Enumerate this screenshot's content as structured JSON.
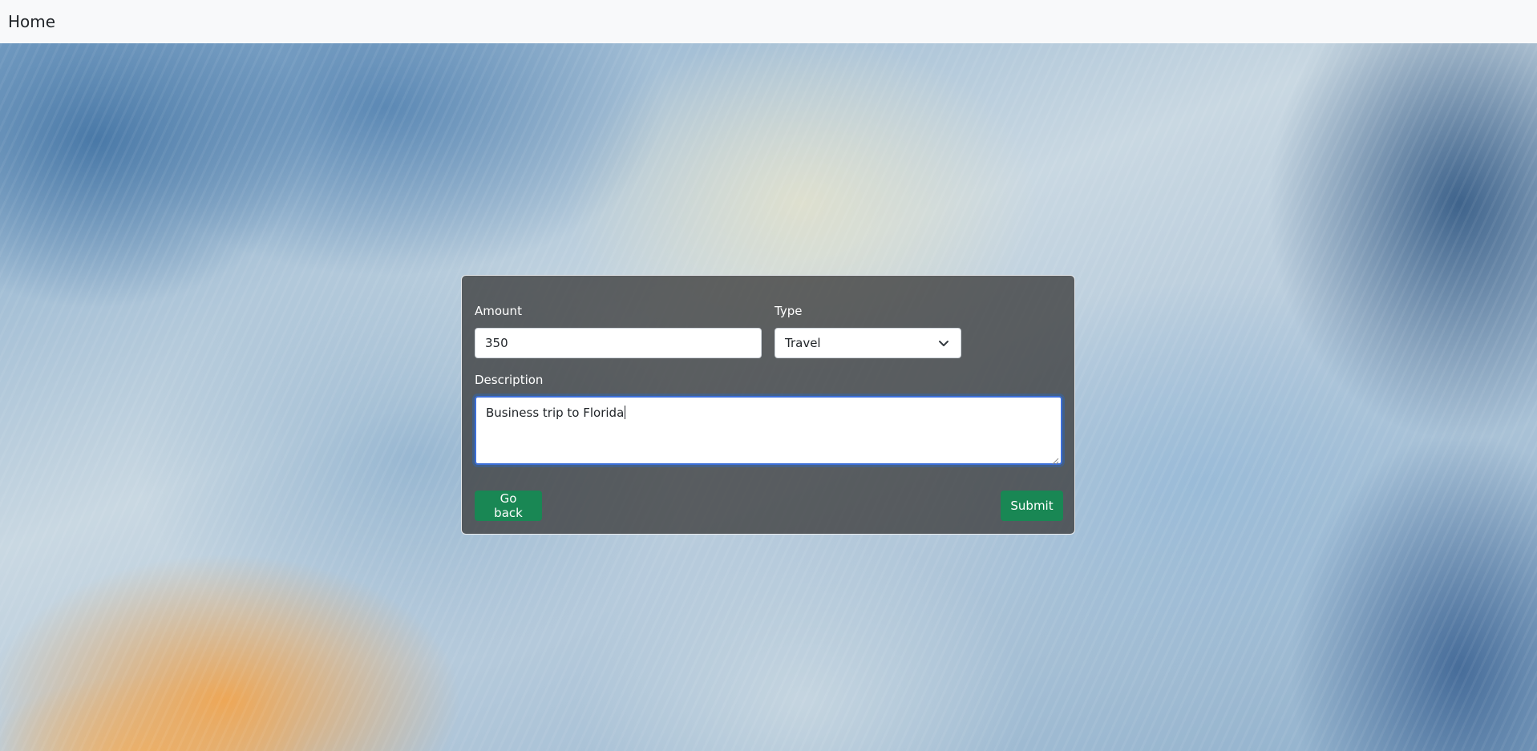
{
  "navbar": {
    "brand": "Home"
  },
  "form": {
    "amount": {
      "label": "Amount",
      "value": "350"
    },
    "type": {
      "label": "Type",
      "selected": "Travel"
    },
    "description": {
      "label": "Description",
      "value": "Business trip to Florida"
    },
    "buttons": {
      "back": "Go back",
      "submit": "Submit"
    }
  },
  "colors": {
    "button": "#198754",
    "focus_border": "#3d6fd9",
    "card_overlay": "rgba(60,60,60,0.78)"
  }
}
